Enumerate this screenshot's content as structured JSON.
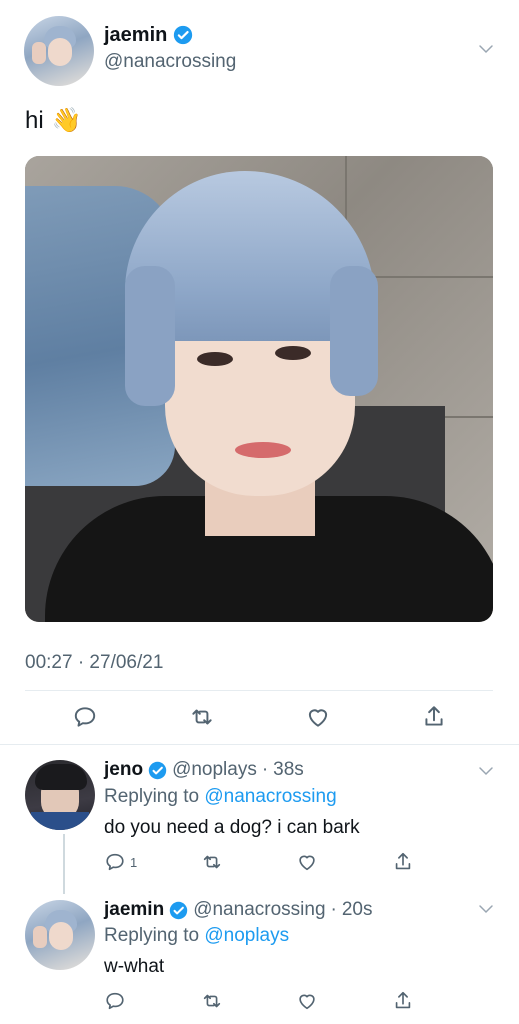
{
  "main_tweet": {
    "name": "jaemin",
    "handle": "@nanacrossing",
    "text": "hi",
    "emoji": "👋",
    "timestamp": "00:27 · 27/06/21"
  },
  "replies": [
    {
      "name": "jeno",
      "handle": "@noplays",
      "sep": "·",
      "time": "38s",
      "replying_prefix": "Replying to",
      "replying_to": "@nanacrossing",
      "text": "do you need a dog? i can bark",
      "reply_count": "1"
    },
    {
      "name": "jaemin",
      "handle": "@nanacrossing",
      "sep": "·",
      "time": "20s",
      "replying_prefix": "Replying to",
      "replying_to": "@noplays",
      "text": "w-what",
      "reply_count": ""
    }
  ],
  "icons": [
    "reply-icon",
    "retweet-icon",
    "like-icon",
    "share-icon",
    "chevron-down-icon",
    "verified-badge-icon"
  ],
  "colors": {
    "accent": "#1d9bf0",
    "muted": "#536471",
    "divider": "#e6ecf0"
  }
}
